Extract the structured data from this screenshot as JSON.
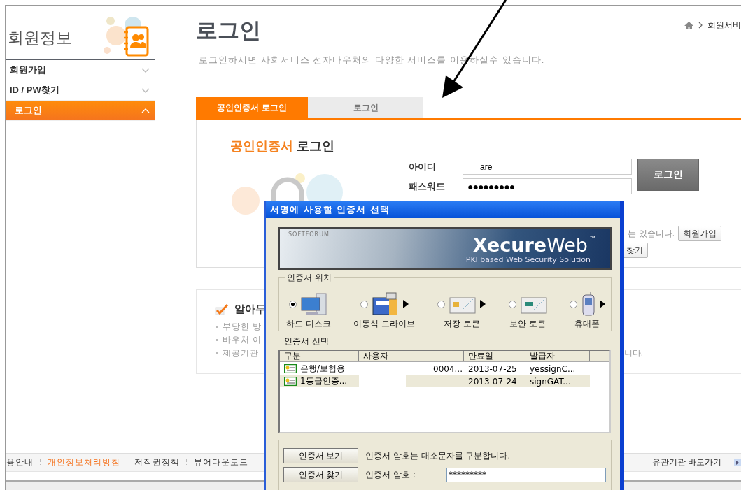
{
  "sidebar": {
    "title": "회원정보",
    "items": [
      {
        "label": "회원가입",
        "selected": false
      },
      {
        "label": "ID / PW찾기",
        "selected": false
      },
      {
        "label": "로그인",
        "selected": true
      }
    ]
  },
  "breadcrumb": {
    "current": "회원서비"
  },
  "page": {
    "title": "로그인",
    "subtitle": "로그인하시면 사회서비스 전자바우처의 다양한 서비스를 이용하실수 있습니다."
  },
  "tabs": [
    {
      "label": "공인인증서 로그인",
      "selected": true
    },
    {
      "label": "로그인",
      "selected": false
    }
  ],
  "login": {
    "heading_accent": "공인인증서",
    "heading": "로그인",
    "fields": [
      {
        "label": "아이디",
        "value": "are"
      },
      {
        "label": "패스워드",
        "value": "●●●●●●●●●"
      }
    ],
    "login_button": "로그인",
    "hint_text": "는 있습니다.",
    "signup_button": "회원가입",
    "find_button": "찾기"
  },
  "notice": {
    "title": "알아두",
    "items": [
      "부당한 방",
      "바우처 이",
      "제공기관"
    ],
    "tail_text": "니다."
  },
  "footer": {
    "links": [
      {
        "label": "용안내",
        "highlighted": false
      },
      {
        "label": "개인정보처리방침",
        "highlighted": true
      },
      {
        "label": "저작권정책",
        "highlighted": false
      },
      {
        "label": "뷰어다운로드",
        "highlighted": false
      }
    ],
    "related": "유관기관 바로가기"
  },
  "dialog": {
    "title": "서명에 사용할 인증서 선택",
    "banner": {
      "vendor": "SOFTFORUM",
      "product": "**Xecure**Web",
      "trademark": "™",
      "tagline": "PKI based Web Security Solution"
    },
    "location_group": "인증서 위치",
    "locations": [
      {
        "label": "하드 디스크",
        "kind": "disk",
        "selected": true,
        "submenu": false
      },
      {
        "label": "이동식 드라이브",
        "kind": "removable",
        "selected": false,
        "submenu": true
      },
      {
        "label": "저장 토큰",
        "kind": "token",
        "selected": false,
        "submenu": true
      },
      {
        "label": "보안 토큰",
        "kind": "hsm",
        "selected": false,
        "submenu": false
      },
      {
        "label": "휴대폰",
        "kind": "phone",
        "selected": false,
        "submenu": true
      }
    ],
    "cert_label": "인증서 선택",
    "columns": [
      "구분",
      "사용자",
      "만료일",
      "발급자"
    ],
    "certs": [
      {
        "type": "은행/보험용",
        "user": "0004...",
        "expiry": "2013-07-25",
        "issuer": "yessignC...",
        "selected": false
      },
      {
        "type": "1등급인증...",
        "expiry": "2013-07-24",
        "issuer": "signGAT...",
        "selected": true
      }
    ],
    "buttons": [
      "인증서 보기",
      "인증서 찾기"
    ],
    "note": "인증서 암호는 대소문자를 구분합니다.",
    "password_label": "인증서 암호 :",
    "password": "*********"
  }
}
